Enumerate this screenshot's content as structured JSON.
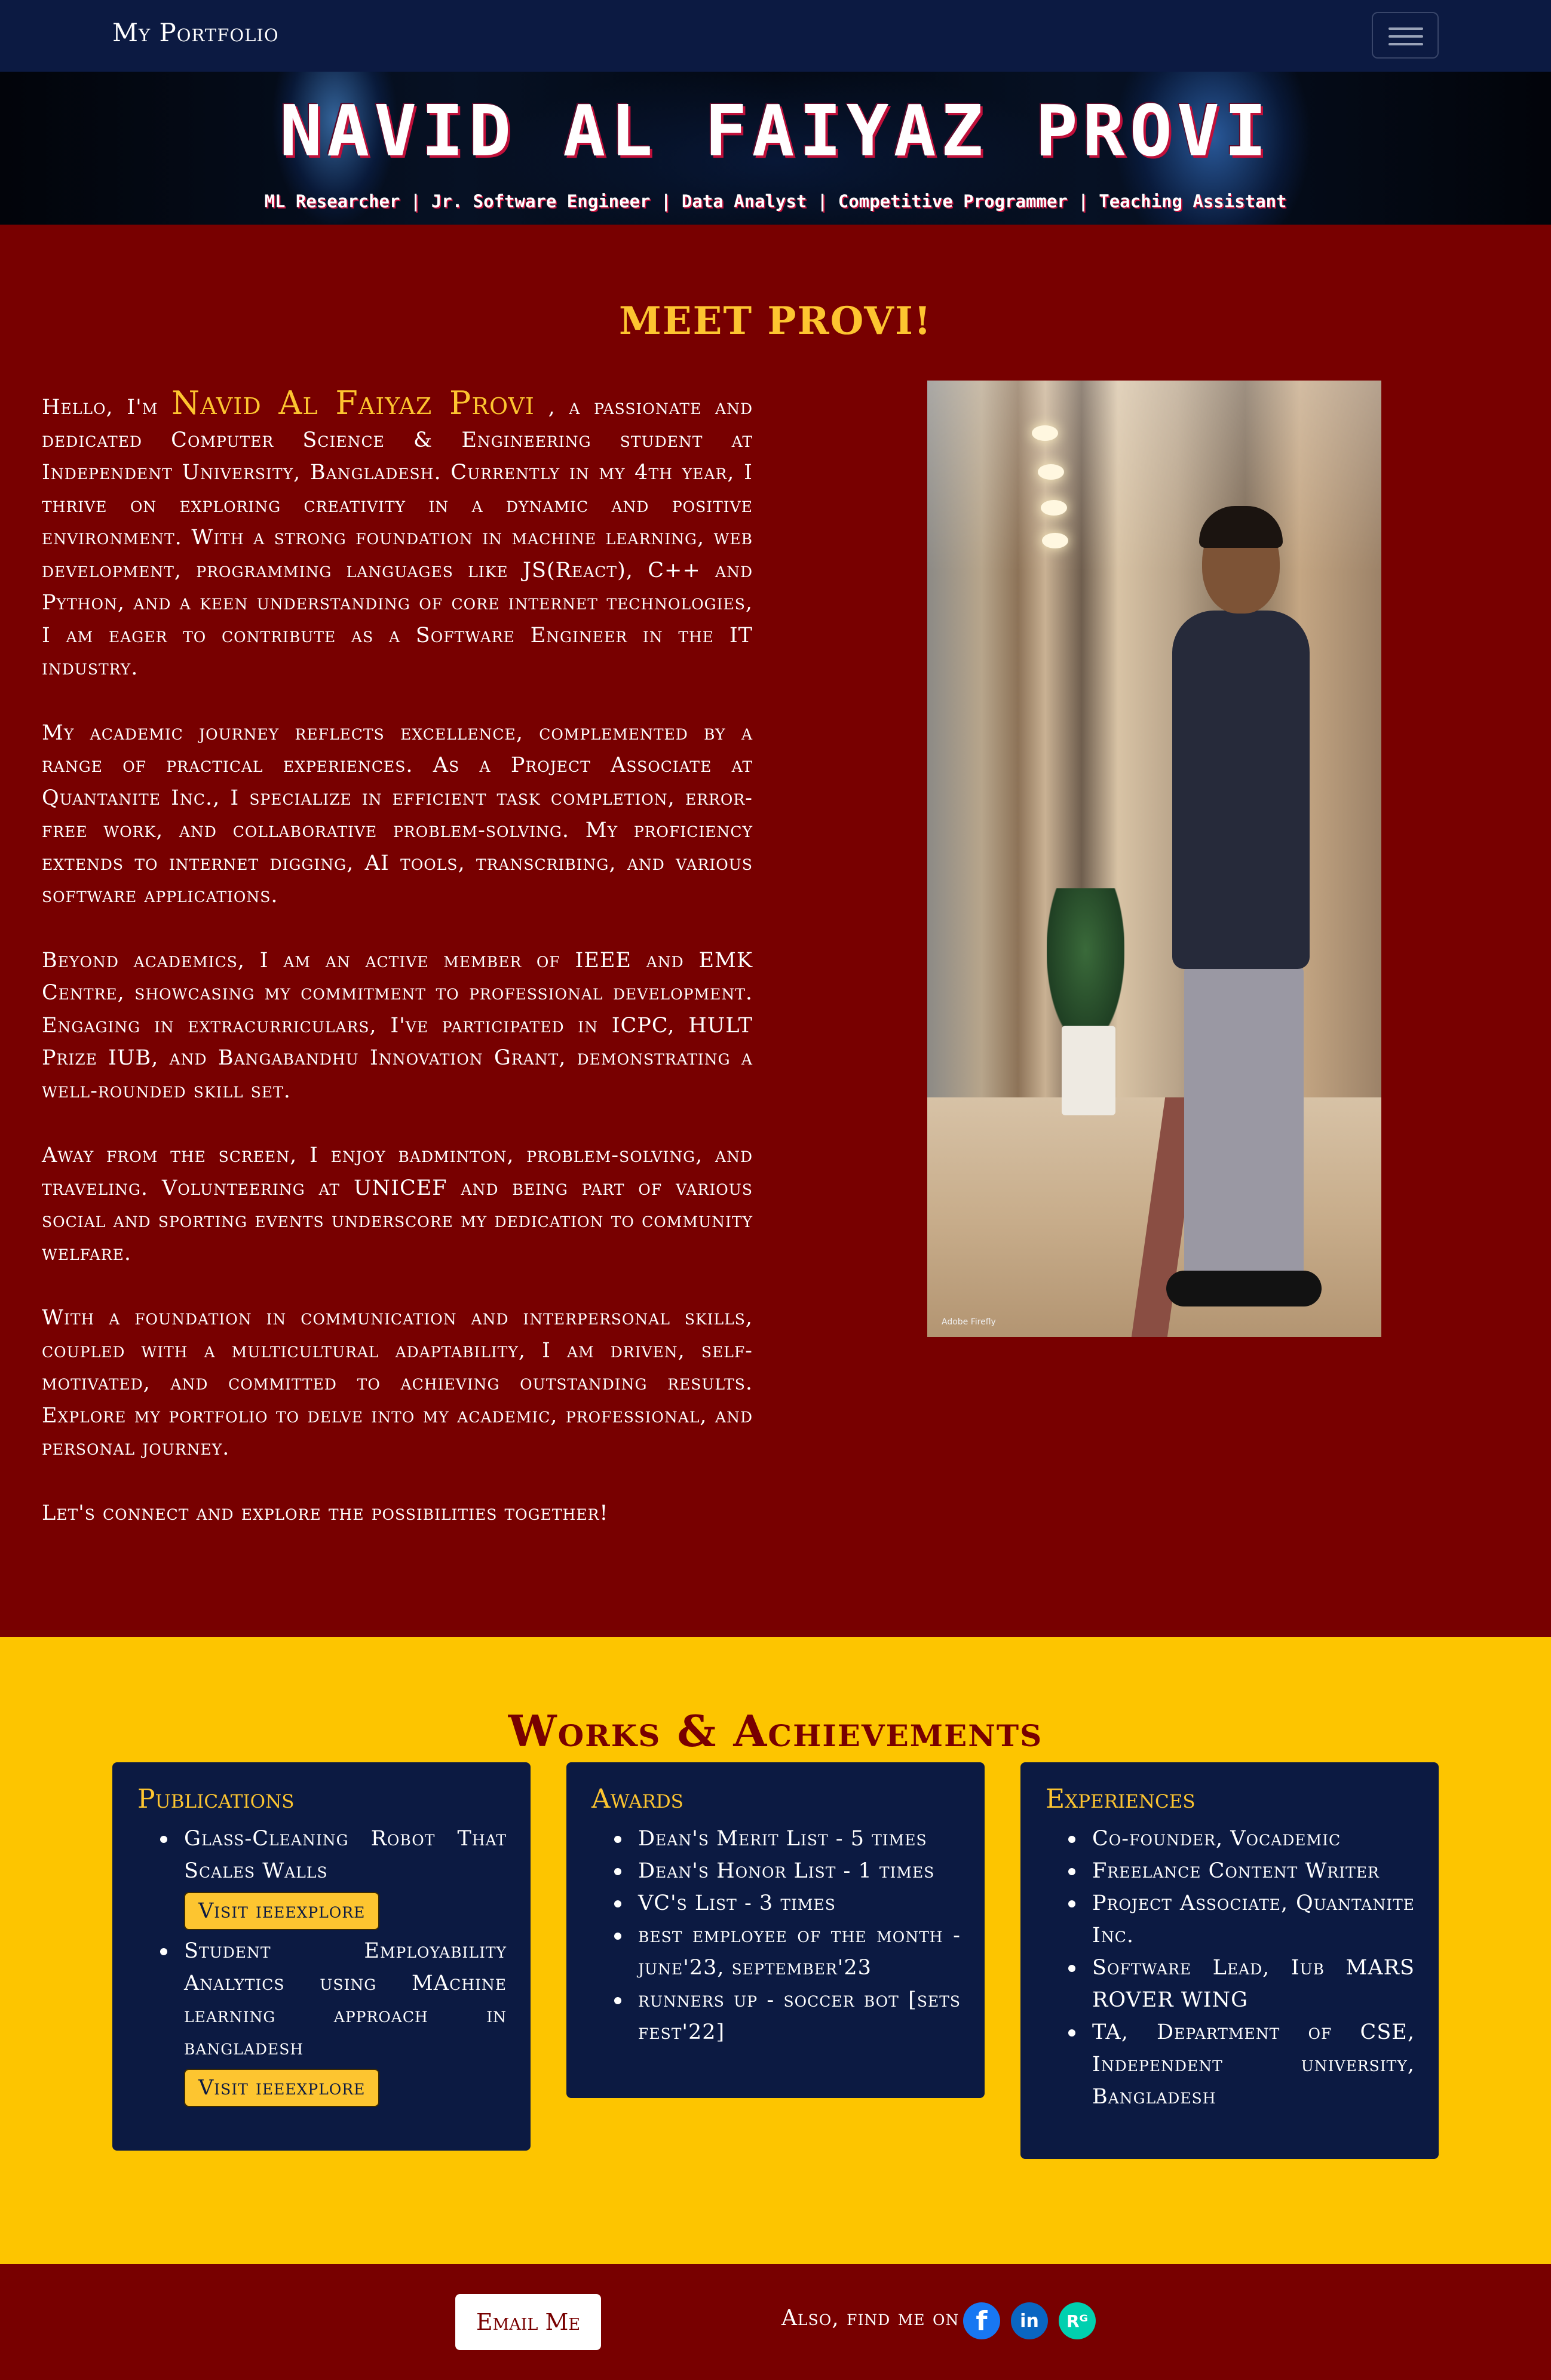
{
  "navbar": {
    "brand": "My Portfolio",
    "toggle_icon": "hamburger-menu-icon"
  },
  "hero": {
    "title": "NAVID AL FAIYAZ PROVI",
    "subtitle": "ML Researcher | Jr. Software Engineer | Data Analyst | Competitive Programmer | Teaching Assistant"
  },
  "about": {
    "heading": "MEET PROVI!",
    "intro_prefix": "Hello, I'm ",
    "name": "Navid Al Faiyaz Provi",
    "intro_rest": " , a passionate and dedicated Computer Science & Engineering student at Independent University, Bangladesh. Currently in my 4th year, I thrive on exploring creativity in a dynamic and positive environment. With a strong foundation in machine learning, web development, programming languages like JS(React), C++ and Python, and a keen understanding of core internet technologies, I am eager to contribute as a Software Engineer in the IT industry.",
    "paragraphs": [
      "My academic journey reflects excellence, complemented by a range of practical experiences. As a Project Associate at Quantanite Inc., I specialize in efficient task completion, error-free work, and collaborative problem-solving. My proficiency extends to internet digging, AI tools, transcribing, and various software applications.",
      "Beyond academics, I am an active member of IEEE and EMK Centre, showcasing my commitment to professional development. Engaging in extracurriculars, I've participated in ICPC, HULT Prize IUB, and Bangabandhu Innovation Grant, demonstrating a well-rounded skill set.",
      "Away from the screen, I enjoy badminton, problem-solving, and traveling. Volunteering at UNICEF and being part of various social and sporting events underscore my dedication to community welfare.",
      "With a foundation in communication and interpersonal skills, coupled with a multicultural adaptability, I am driven, self-motivated, and committed to achieving outstanding results. Explore my portfolio to delve into my academic, professional, and personal journey.",
      "Let's connect and explore the possibilities together!"
    ],
    "photo_caption": "Adobe Firefly"
  },
  "works": {
    "heading": "Works & Achievements",
    "publications": {
      "title": "Publications",
      "items": [
        "Glass-Cleaning Robot That Scales Walls",
        "Student Employability Analytics using MAchine learning approach in bangladesh"
      ],
      "button_label": "Visit ieeexplore"
    },
    "awards": {
      "title": "Awards",
      "items": [
        "Dean's Merit List - 5 times",
        "Dean's Honor List - 1 times",
        "VC's List - 3 times",
        "best employee of the month - june'23, september'23",
        "runners up - soccer bot [sets fest'22]"
      ]
    },
    "experiences": {
      "title": "Experiences",
      "items": [
        "Co-founder, Vocademic",
        "Freelance Content Writer",
        "Project Associate, Quantanite Inc.",
        "Software Lead, Iub MARS ROVER WING",
        "TA, Department of CSE, Independent university, Bangladesh"
      ]
    }
  },
  "footer": {
    "email_label": "Email Me",
    "find_text": "Also, find me on",
    "social_icons": [
      "facebook-icon",
      "linkedin-icon",
      "researchgate-icon"
    ],
    "facebook_glyph": "f",
    "linkedin_glyph": "in",
    "researchgate_glyph": "Rᴳ"
  },
  "colors": {
    "navy": "#0c1a42",
    "maroon": "#780000",
    "gold": "#fdc530",
    "yellow": "#fdc500"
  }
}
